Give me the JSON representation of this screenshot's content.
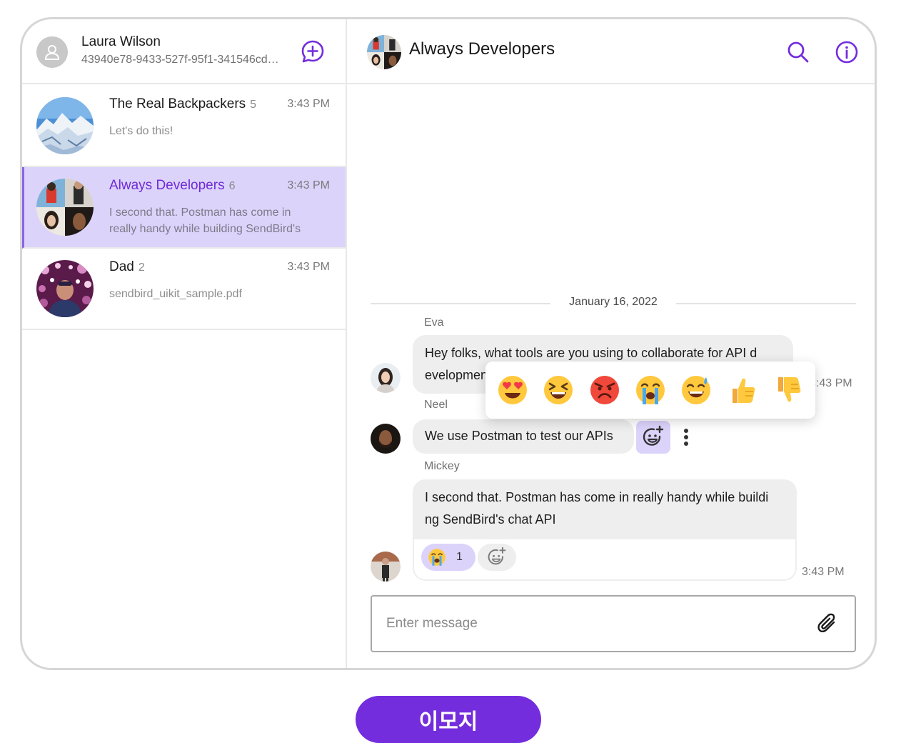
{
  "user": {
    "name": "Laura Wilson",
    "id": "43940e78-9433-527f-95f1-341546cd…"
  },
  "channels": [
    {
      "name": "The Real Backpackers",
      "count": "5",
      "time": "3:43 PM",
      "preview": "Let's do this!"
    },
    {
      "name": "Always Developers",
      "count": "6",
      "time": "3:43 PM",
      "preview": "I second that. Postman has come in really handy while building SendBird's"
    },
    {
      "name": "Dad",
      "count": "2",
      "time": "3:43 PM",
      "preview": "sendbird_uikit_sample.pdf"
    }
  ],
  "chat": {
    "title": "Always Developers",
    "date": "January 16, 2022",
    "messages": [
      {
        "sender": "Eva",
        "text": "Hey folks, what tools are you using to collaborate for API d evelopment?",
        "time": "3:43 PM"
      },
      {
        "sender": "Neel",
        "text": "We use Postman to test our APIs"
      },
      {
        "sender": "Mickey",
        "text": "I second that. Postman has come in really handy while buildi ng SendBird's chat API",
        "time": "3:43 PM",
        "reaction": {
          "emoji": "crying-emoji",
          "count": "1"
        }
      }
    ],
    "emoji_picker": [
      "heart-eyes-emoji",
      "laughing-emoji",
      "angry-emoji",
      "crying-emoji",
      "sweat-smile-emoji",
      "thumbs-up-emoji",
      "thumbs-down-emoji"
    ],
    "input_placeholder": "Enter message"
  },
  "colors": {
    "accent": "#742ddd",
    "active_row": "#dcd3fb",
    "bubble": "#eeeeee"
  },
  "bottom_button": {
    "label": "이모지"
  }
}
